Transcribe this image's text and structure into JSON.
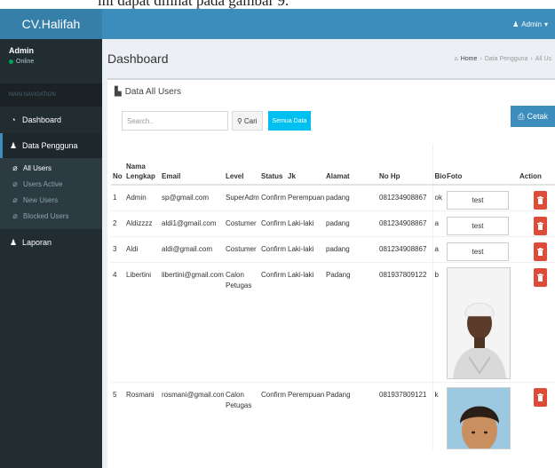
{
  "caption": {
    "text": "ini dapat dilihat pada gambar 9."
  },
  "brand": "CV.Halifah",
  "user": {
    "name": "Admin",
    "status": "Online"
  },
  "sidebar": {
    "header": "MAIN NAVIGATION",
    "dashboard": "Dashboard",
    "data_pengguna": "Data Pengguna",
    "sub": [
      "All Users",
      "Users Active",
      "New Users",
      "Blocked Users"
    ],
    "laporan": "Laporan"
  },
  "topbar": {
    "admin_label": "Admin"
  },
  "page": {
    "title": "Dashboard",
    "breadcrumb": [
      "Home",
      "Data Pengguna",
      "All Us"
    ]
  },
  "box": {
    "title": "Data All Users",
    "search_placeholder": "Search..",
    "cari_label": "Cari",
    "semua_label": "Semua Data",
    "cetak_label": "Cetak"
  },
  "table": {
    "headers": [
      "No",
      "Nama Lengkap",
      "Email",
      "Level",
      "Status",
      "Jk",
      "Alamat",
      "No Hp",
      "Bio",
      "Foto",
      "Action"
    ],
    "rows": [
      {
        "no": "1",
        "nama": "Admin",
        "email": "sp@gmail.com",
        "level": "SuperAdmin",
        "status": "Confirm",
        "jk": "Perempuan",
        "alamat": "padang",
        "nohp": "081234908867",
        "bio": "ok",
        "foto": "test"
      },
      {
        "no": "2",
        "nama": "Aldizzzz",
        "email": "aldi1@gmail.com",
        "level": "Costumer",
        "status": "Confirm",
        "jk": "Laki-laki",
        "alamat": "padang",
        "nohp": "081234908867",
        "bio": "a",
        "foto": "test"
      },
      {
        "no": "3",
        "nama": "Aldi",
        "email": "aldi@gmail.com",
        "level": "Costumer",
        "status": "Confirm",
        "jk": "Laki-laki",
        "alamat": "padang",
        "nohp": "081234908867",
        "bio": "a",
        "foto": "test"
      },
      {
        "no": "4",
        "nama": "Libertini",
        "email": "libertini@gmail.com",
        "level": "Calon Petugas",
        "status": "Confirm",
        "jk": "Laki-laki",
        "alamat": "Padang",
        "nohp": "081937809122",
        "bio": "b",
        "foto": ""
      },
      {
        "no": "5",
        "nama": "Rosmani",
        "email": "rosmani@gmail.com",
        "level": "Calon Petugas",
        "status": "Confirm",
        "jk": "Perempuan",
        "alamat": "Padang",
        "nohp": "081937809121",
        "bio": "k",
        "foto": ""
      }
    ]
  },
  "colors": {
    "logo": "#367fa9",
    "topbar": "#3c8dbc",
    "sidebar": "#222d32",
    "online": "#00a65a",
    "btn_info": "#00c0ef",
    "btn_danger": "#dd4b39"
  },
  "icons": {
    "dashboard": "gauge-icon",
    "users": "users-icon",
    "link": "link-icon",
    "home": "home-icon",
    "file": "file-icon",
    "print": "print-icon",
    "search": "search-icon",
    "trash": "trash-icon"
  }
}
